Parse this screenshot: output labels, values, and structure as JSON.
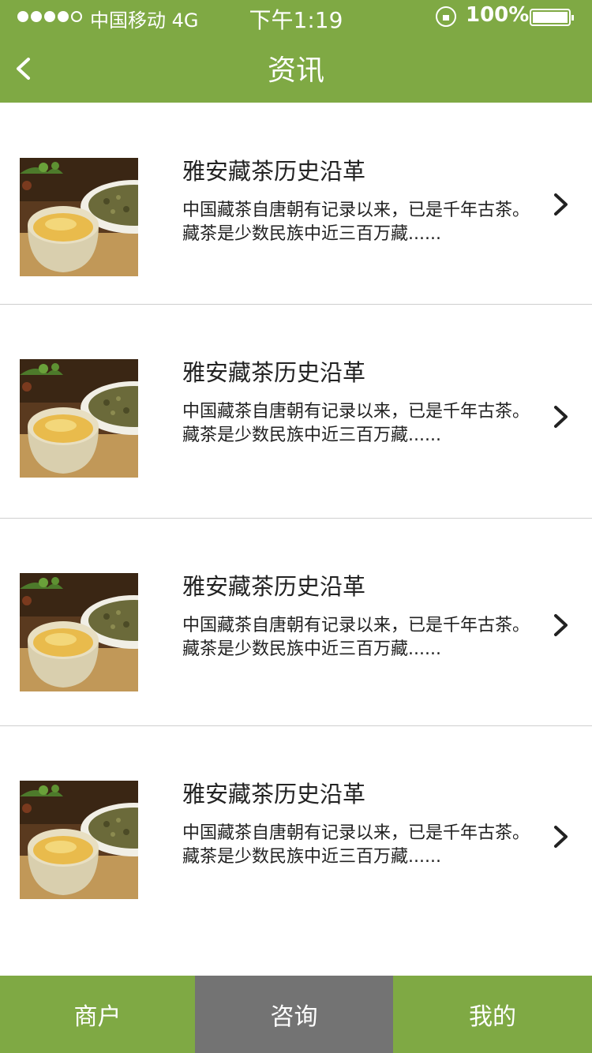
{
  "status_bar": {
    "carrier": "中国移动  4G",
    "time": "下午1:19",
    "battery": "100%"
  },
  "nav": {
    "title": "资讯",
    "back_icon": "chevron-left-icon"
  },
  "articles": [
    {
      "title": "雅安藏茶历史沿革",
      "desc": "中国藏茶自唐朝有记录以来，已是千年古茶。藏茶是少数民族中近三百万藏......",
      "image": "tea-cup-thumbnail"
    },
    {
      "title": "雅安藏茶历史沿革",
      "desc": "中国藏茶自唐朝有记录以来，已是千年古茶。藏茶是少数民族中近三百万藏......",
      "image": "tea-cup-thumbnail"
    },
    {
      "title": "雅安藏茶历史沿革",
      "desc": "中国藏茶自唐朝有记录以来，已是千年古茶。藏茶是少数民族中近三百万藏......",
      "image": "tea-cup-thumbnail"
    },
    {
      "title": "雅安藏茶历史沿革",
      "desc": "中国藏茶自唐朝有记录以来，已是千年古茶。藏茶是少数民族中近三百万藏......",
      "image": "tea-cup-thumbnail"
    }
  ],
  "tabs": [
    {
      "label": "商户",
      "active": false
    },
    {
      "label": "咨询",
      "active": true
    },
    {
      "label": "我的",
      "active": false
    }
  ],
  "colors": {
    "brand_green": "#7fa944",
    "active_tab": "#737373",
    "divider": "#cfcfcf"
  }
}
